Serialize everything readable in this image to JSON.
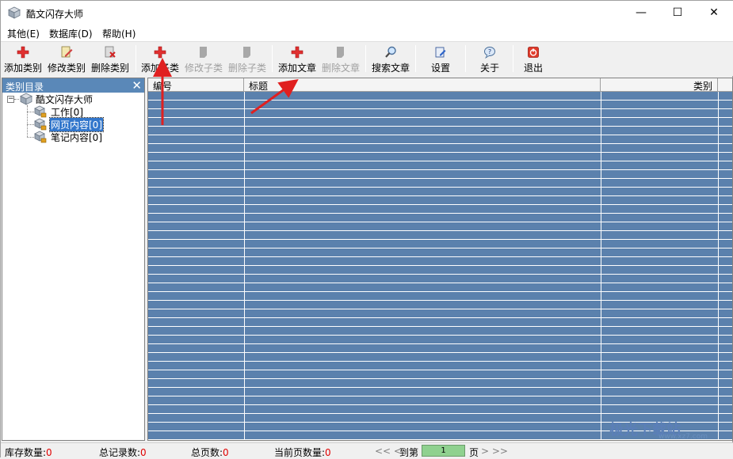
{
  "window": {
    "title": "酷文闪存大师",
    "min_glyph": "—",
    "max_glyph": "☐",
    "close_glyph": "✕"
  },
  "menu": [
    {
      "label": "其他(E)"
    },
    {
      "label": "数据库(D)"
    },
    {
      "label": "帮助(H)"
    }
  ],
  "toolbar": [
    {
      "label": "添加类别",
      "icon": "add-icon",
      "enabled": true
    },
    {
      "label": "修改类别",
      "icon": "edit-icon",
      "enabled": true
    },
    {
      "label": "删除类别",
      "icon": "delete-icon",
      "enabled": true
    },
    {
      "label": "添加子类",
      "icon": "add-icon",
      "enabled": true
    },
    {
      "label": "修改子类",
      "icon": "edit-icon",
      "enabled": false
    },
    {
      "label": "删除子类",
      "icon": "delete-icon",
      "enabled": false
    },
    {
      "label": "添加文章",
      "icon": "add-icon",
      "enabled": true
    },
    {
      "label": "删除文章",
      "icon": "delete-icon",
      "enabled": false
    },
    {
      "label": "搜索文章",
      "icon": "search-icon",
      "enabled": true
    },
    {
      "label": "设置",
      "icon": "settings-icon",
      "enabled": true
    },
    {
      "label": "关于",
      "icon": "about-icon",
      "enabled": true
    },
    {
      "label": "退出",
      "icon": "exit-icon",
      "enabled": true
    }
  ],
  "category_panel": {
    "title": "类别目录",
    "close_glyph": "✕",
    "expander": "−",
    "root": "酷文闪存大师",
    "children": [
      {
        "label": "工作[0]",
        "selected": false
      },
      {
        "label": "网页内容[0]",
        "selected": true
      },
      {
        "label": "笔记内容[0]",
        "selected": false
      }
    ]
  },
  "grid": {
    "columns": [
      "编号",
      "标题",
      "类别"
    ]
  },
  "status": {
    "stock_label": "库存数量:",
    "stock_value": "0",
    "total_label": "总记录数:",
    "total_value": "0",
    "pages_label": "总页数:",
    "pages_value": "0",
    "current_label": "当前页数量:",
    "current_value": "0",
    "prev_glyph": "<< <",
    "goto_label": "到第",
    "page_value": "1",
    "page_unit": "页",
    "next_glyph": "> >>"
  },
  "watermark": {
    "text": "极光下载站",
    "sub": "www.xz7.com"
  },
  "colors": {
    "grid_row": "#5b81ad",
    "panel_header": "#5a88b8",
    "annotation_arrow": "#e02020",
    "status_value": "#e00000"
  }
}
